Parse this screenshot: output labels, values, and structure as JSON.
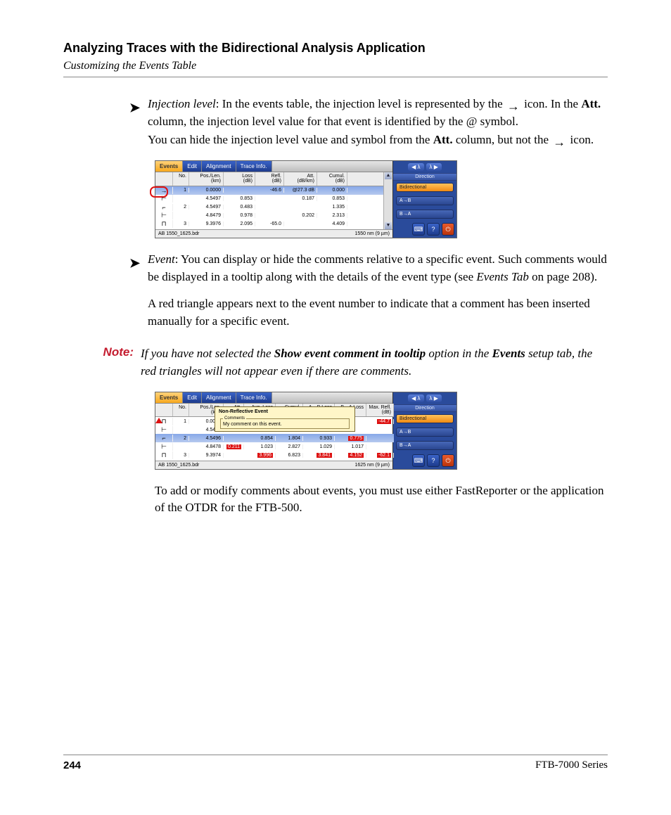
{
  "header": {
    "chapter": "Analyzing Traces with the Bidirectional Analysis Application",
    "section": "Customizing the Events Table"
  },
  "bullets": {
    "injection": {
      "term": "Injection level",
      "p1a": ": In the events table, the injection level is represented by the ",
      "p1b": " icon. In the ",
      "att": "Att.",
      "p1c": " column, the injection level value for that event is identified by the @ symbol.",
      "p2a": "You can hide the injection level value and symbol from the ",
      "p2b": " column, but not the ",
      "p2c": " icon."
    },
    "event": {
      "term": "Event",
      "p1": ": You can display or hide the comments relative to a specific event. Such comments would be displayed in a tooltip along with the details of the event type (see ",
      "ref": "Events Tab",
      "p1b": " on page 208).",
      "p2": "A red triangle appears next to the event number to indicate that a comment has been inserted manually for a specific event."
    }
  },
  "note": {
    "label": "Note:",
    "t1": "If you have not selected the ",
    "b1": "Show event comment in tooltip",
    "t2": " option in the ",
    "b2": "Events",
    "t3": " setup tab, the red triangles will not appear even if there are comments."
  },
  "trailing_para": "To add or modify comments about events, you must use either FastReporter or the application of the OTDR for the FTB-500.",
  "footer": {
    "page": "244",
    "series": "FTB-7000 Series"
  },
  "shot1": {
    "tabs": [
      "Events",
      "Edit",
      "Alignment",
      "Trace Info."
    ],
    "headers": {
      "icon": "",
      "no": "No.",
      "pos": "Pos./Len.\n(km)",
      "loss": "Loss\n(dB)",
      "refl": "Refl.\n(dB)",
      "att": "Att.\n(dB/km)",
      "cum": "Cumul.\n(dB)"
    },
    "rows": [
      {
        "icon": "→",
        "no": "1",
        "pos": "0.0000",
        "loss": "",
        "refl": "-46.6",
        "att": "@27.3 dB",
        "cum": "0.000",
        "sel": true
      },
      {
        "icon": "⊢",
        "no": "",
        "pos": "4.5497",
        "loss": "0.853",
        "refl": "",
        "att": "0.187",
        "cum": "0.853"
      },
      {
        "icon": "⌐",
        "no": "2",
        "pos": "4.5497",
        "loss": "0.483",
        "refl": "",
        "att": "",
        "cum": "1.335"
      },
      {
        "icon": "⊢",
        "no": "",
        "pos": "4.8479",
        "loss": "0.978",
        "refl": "",
        "att": "0.202",
        "cum": "2.313"
      },
      {
        "icon": "⊓",
        "no": "3",
        "pos": "9.3976",
        "loss": "2.095",
        "refl": "-65.0",
        "att": "",
        "cum": "4.409"
      }
    ],
    "status": {
      "file": "AB 1550_1625.bdr",
      "right": "1550 nm (9 µm)"
    },
    "side": {
      "lambda_left": "◀ λ",
      "lambda_right": "λ ▶",
      "direction_label": "Direction",
      "bidir": "Bidirectional",
      "ab": "A→B",
      "ba": "B→A"
    }
  },
  "shot2": {
    "tabs": [
      "Events",
      "Edit",
      "Alignment",
      "Trace Info."
    ],
    "headers": {
      "icon": "",
      "no": "No.",
      "pos": "Pos./Len.\n(km)",
      "att": "Att.",
      "loss": "Avg. Loss",
      "cum": "Cumul.",
      "ab": "A→B Loss",
      "ba": "B→A Loss",
      "mref": "Max. Refl.\n(dB)"
    },
    "rows": [
      {
        "icon": "⊓",
        "no": "1",
        "pos": "0.0000",
        "att": "",
        "loss": "",
        "cum": "",
        "ab": "",
        "ba": "",
        "mref": "-44.7",
        "mref_red": true,
        "triangle": true
      },
      {
        "icon": "⊢",
        "no": "",
        "pos": "4.5496",
        "att": "",
        "loss": "",
        "cum": "",
        "ab": "",
        "ba": "",
        "mref": ""
      },
      {
        "icon": "⌐",
        "no": "2",
        "pos": "4.5496",
        "att": "",
        "loss": "0.854",
        "cum": "1.804",
        "ab": "0.933",
        "ba": "0.775",
        "mref": "",
        "sel": true,
        "ba_red": true
      },
      {
        "icon": "⊢",
        "no": "",
        "pos": "4.8478",
        "att": "0.211",
        "att_red": true,
        "loss": "1.023",
        "cum": "2.827",
        "ab": "1.029",
        "ba": "1.017",
        "mref": ""
      },
      {
        "icon": "⊓",
        "no": "3",
        "pos": "9.3974",
        "att": "",
        "loss": "3.996",
        "loss_red": true,
        "cum": "6.823",
        "ab": "3.841",
        "ab_red": true,
        "ba": "4.152",
        "ba_red": true,
        "mref": "-62.1",
        "mref_red": true
      }
    ],
    "tooltip": {
      "title": "Non-Reflective Event",
      "comments_label": "Comments",
      "comment": "My comment on this event."
    },
    "status": {
      "file": "AB 1550_1625.bdr",
      "right": "1625 nm (9 µm)"
    }
  }
}
